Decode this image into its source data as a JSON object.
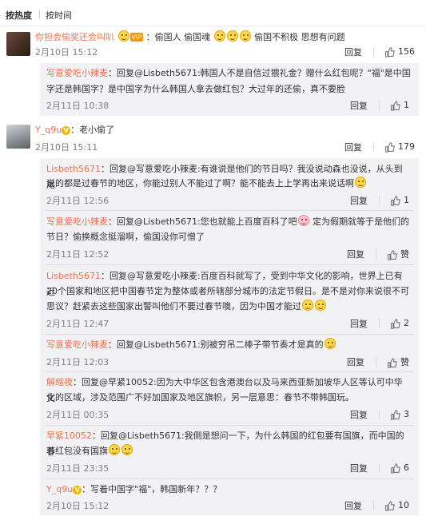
{
  "sort": {
    "hot": "按热度",
    "time": "按时间"
  },
  "labels": {
    "reply": "回复",
    "like": "赞"
  },
  "comments": [
    {
      "user": "你担会偷奖还会叫叭",
      "badge": "VIP",
      "text_before": "：偷国人 偷国魂",
      "text_after": " 偷国不积极 思想有问题",
      "time": "2月10日 15:12",
      "likes": "156"
    },
    {
      "user": "Y_q9u",
      "text": "：老小偷了",
      "time": "2月10日 15:11",
      "likes": "179"
    }
  ],
  "replies_group1": [
    {
      "line1": "写意爱吃小辣麦：回复@Lisbeth5671:韩国人不是自信过猥礼金？赠什么红包呢？\"福\"是中国",
      "line2": "字还是韩国字？是中国字为什么韩国人拿去做红包？大过年的还偷，真不要脸",
      "time": "2月11日 10:38",
      "likes": "1"
    }
  ],
  "replies_group2": [
    {
      "line1": "Lisbeth5671：回复@写意爱吃小辣麦:有谁说是他们的节日吗？我没说动森也没说，从头到尾",
      "line2": "说的都是过春节的地区，你能过别人不能过了啊？能不能去上上学再出来说话啊",
      "time": "2月11日 12:56",
      "likes": "1"
    },
    {
      "line1": "写意爱吃小辣麦：回复@Lisbeth5671:您也就能上百度百科了吧",
      "line1b": " 定为假期就等于是他们的",
      "line2": "节日？偷换概念挺溜啊，偷国没你可憎了",
      "time": "2月11日 12:52",
      "likes": "赞"
    },
    {
      "line1": "Lisbeth5671：回复@写意爱吃小辣麦:百度百科就写了，受到中华文化的影响，世界上已有近",
      "line2": "20个国家和地区把中国春节定为整体或者所辖部分城市的法定节假日。是不是对你来说很不可",
      "line3": "思议？赶紧去这些国家出警叫他们不要过春节噢，因为中国才能过",
      "time": "2月11日 12:47",
      "likes": "2"
    },
    {
      "line1": "写意爱吃小辣麦：回复@Lisbeth5671:别被穷吊二棒子带节奏才是真的",
      "time": "2月11日 12:03",
      "likes": "赞"
    },
    {
      "line1": "解缩夜：回复@早紧10052:因为大中华区包含港澳台以及马来西亚新加坡华人区等认可中华文",
      "line2": "化的区域，涉及范围广不好加国家及地区旗帜，另一层意思：春节不带韩国玩。",
      "time": "2月11日 00:35",
      "likes": "3"
    },
    {
      "line1": "早紧10052：回复@Lisbeth5671:我倒是想问一下，为什么韩国的红包要有国旗，而中国的春",
      "line2": "节红包没有国旗",
      "time": "2月11日 23:35",
      "likes": "6"
    },
    {
      "line1": "Y_q9u",
      "line1b": "：写着中国字\"福\"，韩国新年？？？",
      "time": "2月10日 15:12",
      "likes": "10"
    }
  ]
}
